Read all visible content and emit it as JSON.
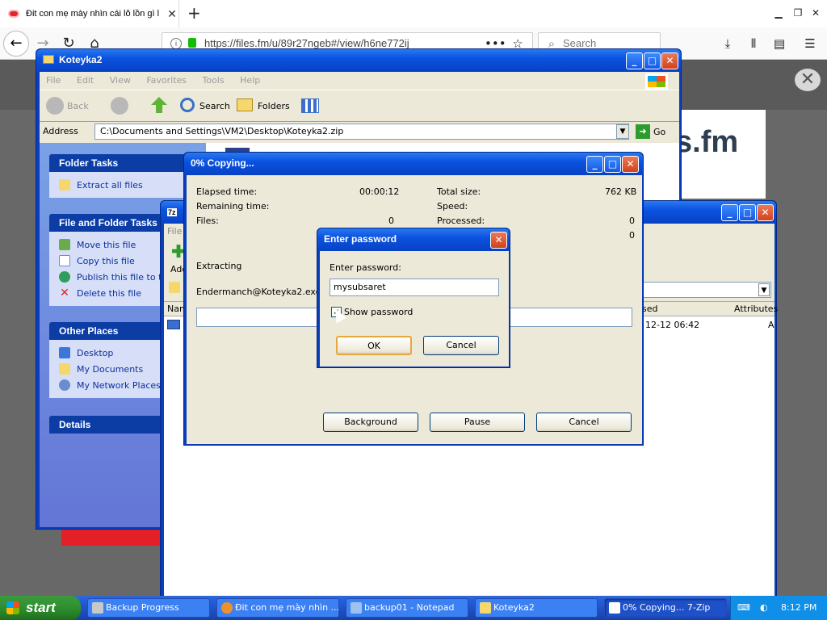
{
  "browser": {
    "tab_title": "Đit con mẹ mày nhìn cái lỗ lồn gì l",
    "url": "https://files.fm/u/89r27ngeb#/view/h6ne772ij",
    "search_placeholder": "Search",
    "site_logo": "s.fm"
  },
  "explorer": {
    "title": "Koteyka2",
    "menu": [
      "File",
      "Edit",
      "View",
      "Favorites",
      "Tools",
      "Help"
    ],
    "toolbar": {
      "back": "Back",
      "search": "Search",
      "folders": "Folders"
    },
    "address_label": "Address",
    "address": "C:\\Documents and Settings\\VM2\\Desktop\\Koteyka2.zip",
    "go": "Go",
    "folder_tasks": {
      "title": "Folder Tasks",
      "items": [
        "Extract all files"
      ]
    },
    "file_tasks": {
      "title": "File and Folder Tasks",
      "items": [
        "Move this file",
        "Copy this file",
        "Publish this file to the Web",
        "Delete this file"
      ]
    },
    "other_places": {
      "title": "Other Places",
      "items": [
        "Desktop",
        "My Documents",
        "My Network Places"
      ]
    },
    "details": {
      "title": "Details"
    }
  },
  "zip": {
    "title": "7z",
    "menu_file": "File",
    "add_label": "Add",
    "col_name": "Nam",
    "col_modified": "sed",
    "col_attributes": "Attributes",
    "row_date": "12-12 06:42",
    "row_attr": "A"
  },
  "copy": {
    "title": "0% Copying...",
    "elapsed_label": "Elapsed time:",
    "elapsed_value": "00:00:12",
    "remaining_label": "Remaining time:",
    "files_label": "Files:",
    "files_value": "0",
    "total_label": "Total size:",
    "total_value": "762 KB",
    "speed_label": "Speed:",
    "processed_label": "Processed:",
    "processed_value": "0",
    "extra_value": "0",
    "status": "Extracting",
    "file": "Endermanch@Koteyka2.exe",
    "progress": 0,
    "background_btn": "Background",
    "pause_btn": "Pause",
    "cancel_btn": "Cancel"
  },
  "password": {
    "title": "Enter password",
    "prompt": "Enter password:",
    "value": "mysubsaret",
    "show_label": "Show password",
    "show_checked": true,
    "ok": "OK",
    "cancel": "Cancel"
  },
  "taskbar": {
    "start": "start",
    "items": [
      "Backup Progress",
      "Đit con mẹ mày nhìn ...",
      "backup01 - Notepad",
      "Koteyka2",
      "0% Copying... 7-Zip"
    ],
    "time": "8:12 PM"
  }
}
